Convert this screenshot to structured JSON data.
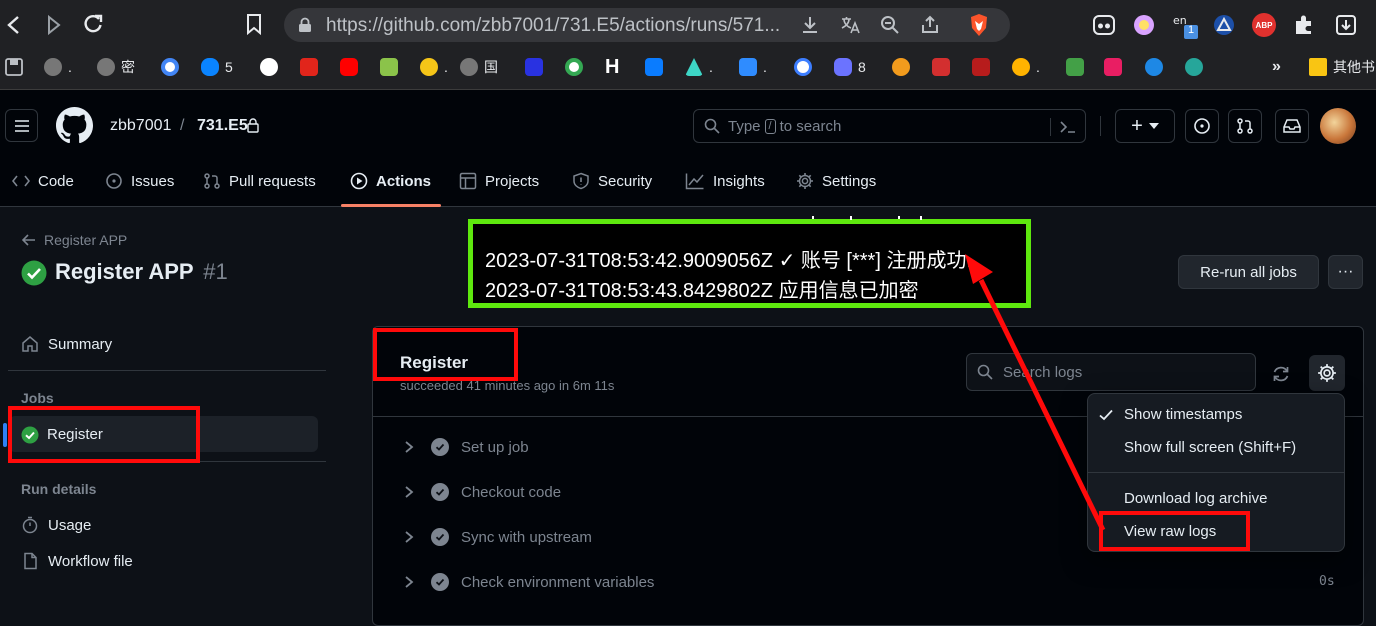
{
  "browser": {
    "url": "https://github.com/zbb7001/731.E5/actions/runs/571...",
    "bookmarks": [
      {
        "label": "."
      },
      {
        "label": "密"
      },
      {
        "label": "5"
      },
      {
        "label": "."
      },
      {
        "label": "国"
      },
      {
        "label": "."
      },
      {
        "label": "."
      },
      {
        "label": "8"
      },
      {
        "label": "."
      },
      {
        "label": "其他书"
      }
    ],
    "ext_badge": "1",
    "abp_label": "ABP",
    "colors": {
      "brave": "#fb542b",
      "abp": "#e0312e"
    }
  },
  "header": {
    "owner": "zbb7001",
    "separator": "/",
    "repo": "731.E5",
    "search_placeholder_pre": "Type",
    "search_key": "/",
    "search_placeholder_post": "to search",
    "plus_label": "+"
  },
  "tabs": [
    {
      "label": "Code",
      "icon": "code-icon"
    },
    {
      "label": "Issues",
      "icon": "issue-icon"
    },
    {
      "label": "Pull requests",
      "icon": "pull-request-icon"
    },
    {
      "label": "Actions",
      "icon": "play-icon",
      "selected": true
    },
    {
      "label": "Projects",
      "icon": "table-icon"
    },
    {
      "label": "Security",
      "icon": "shield-icon"
    },
    {
      "label": "Insights",
      "icon": "graph-icon"
    },
    {
      "label": "Settings",
      "icon": "gear-icon"
    }
  ],
  "run": {
    "breadcrumb": "Register APP",
    "title": "Register APP",
    "number": "#1",
    "rerun_label": "Re-run all jobs",
    "more_label": "···"
  },
  "sidebar": {
    "summary": "Summary",
    "jobs_heading": "Jobs",
    "job": "Register",
    "run_details_heading": "Run details",
    "usage": "Usage",
    "workflow_file": "Workflow file"
  },
  "job": {
    "name": "Register",
    "status": "succeeded 41 minutes ago in 6m 11s",
    "search_placeholder": "Search logs",
    "steps": [
      {
        "label": "Set up job",
        "duration": ""
      },
      {
        "label": "Checkout code",
        "duration": ""
      },
      {
        "label": "Sync with upstream",
        "duration": ""
      },
      {
        "label": "Check environment variables",
        "duration": "0s"
      }
    ]
  },
  "menu": {
    "items": [
      "Show timestamps",
      "Show full screen (Shift+F)",
      "Download log archive",
      "View raw logs"
    ],
    "checked": "Show timestamps"
  },
  "log_overlay": {
    "lines": [
      "2023-07-31T08:53:42.9009056Z ✓ 账号 [***] 注册成功.",
      "2023-07-31T08:53:43.8429802Z 应用信息已加密"
    ]
  },
  "colors": {
    "success": "#2ea043",
    "accent_underline": "#f78166",
    "annotation_red": "#ff0a0a",
    "annotation_green": "#5ee80e"
  }
}
